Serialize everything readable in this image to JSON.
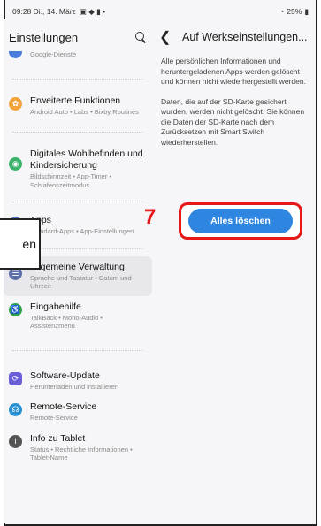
{
  "statusbar": {
    "time_date": "09:28 Di., 14. März",
    "battery": "25%"
  },
  "left": {
    "title": "Einstellungen",
    "items": [
      {
        "label": "",
        "sub": "Google-Dienste",
        "color": "#4a7cdb"
      },
      {
        "label": "Erweiterte Funktionen",
        "sub": "Android Auto • Labs • Bixby Routines",
        "color": "#f2a33a"
      },
      {
        "label": "Digitales Wohlbefinden und Kindersicherung",
        "sub": "Bildschirmzeit • App-Timer • Schlafenszeitmodus",
        "color": "#3bb26a"
      },
      {
        "label": "Apps",
        "sub": "Standard-Apps • App-Einstellungen",
        "color": "#5b7bd8"
      },
      {
        "label": "Allgemeine Verwaltung",
        "sub": "Sprache und Tastatur • Datum und Uhrzeit",
        "color": "#5c6fa8"
      },
      {
        "label": "Eingabehilfe",
        "sub": "TalkBack • Mono-Audio • Assistenzmenü",
        "color": "#2fa04a"
      },
      {
        "label": "Software-Update",
        "sub": "Herunterladen und installieren",
        "color": "#6a5fd8"
      },
      {
        "label": "Remote-Service",
        "sub": "Remote-Service",
        "color": "#2a8fd0"
      },
      {
        "label": "Info zu Tablet",
        "sub": "Status • Rechtliche Informationen • Tablet-Name",
        "color": "#555555"
      }
    ]
  },
  "right": {
    "title": "Auf Werkseinstellungen...",
    "paragraph1": "Alle persönlichen Informationen und heruntergeladenen Apps werden gelöscht und können nicht wiederhergestellt werden.",
    "paragraph2": "Daten, die auf der SD-Karte gesichert wurden, werden nicht gelöscht. Sie können die Daten der SD-Karte nach dem Zurücksetzen mit Smart Switch wiederherstellen.",
    "button_label": "Alles löschen"
  },
  "annotation": {
    "step": "7",
    "callout_text": "en"
  }
}
